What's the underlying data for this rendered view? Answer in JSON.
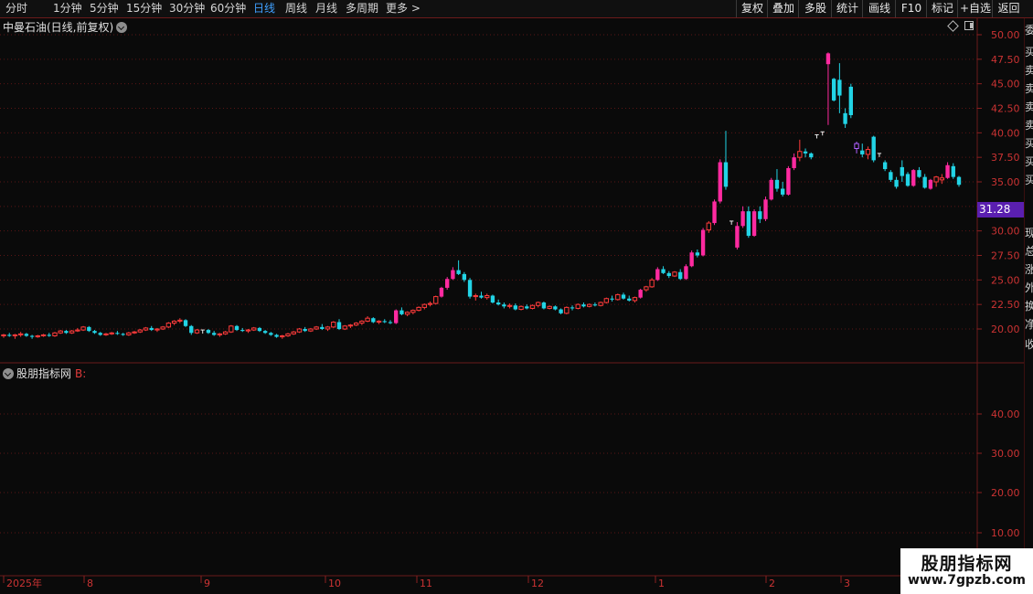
{
  "toolbar": {
    "left": [
      "分时",
      "1分钟",
      "5分钟",
      "15分钟",
      "30分钟",
      "60分钟",
      "日线",
      "周线",
      "月线",
      "多周期",
      "更多 >"
    ],
    "active_index": 6,
    "right": [
      "复权",
      "叠加",
      "多股",
      "统计",
      "画线",
      "F10",
      "标记",
      "+自选",
      "返回"
    ]
  },
  "chart": {
    "title": "中曼石油(日线,前复权)",
    "last_price": "31.28",
    "price_ticks": [
      "50.00",
      "47.50",
      "45.00",
      "42.50",
      "40.00",
      "37.50",
      "35.00",
      "32.50",
      "30.00",
      "27.50",
      "25.00",
      "22.50",
      "20.00"
    ],
    "annotation_high": "T",
    "annotation_low": "T"
  },
  "indicator": {
    "title": "股朋指标网",
    "series_label": "B:",
    "ticks": [
      "40.00",
      "30.00",
      "20.00",
      "10.00"
    ]
  },
  "date_axis": {
    "labels": [
      "2025年",
      "8",
      "9",
      "10",
      "11",
      "12",
      "1",
      "2",
      "3"
    ]
  },
  "sidebar": {
    "chars": [
      "委",
      "买",
      "卖",
      "卖",
      "卖",
      "卖",
      "买",
      "买",
      "买",
      "现",
      "总",
      "涨",
      "外",
      "换",
      "净",
      "收"
    ]
  },
  "watermark": {
    "title": "股朋指标网",
    "url": "www.7gpzb.com"
  },
  "colors": {
    "up": "#ff3b3b",
    "up_strong": "#ff2aa0",
    "down": "#22d4e6",
    "grid": "#6b1a1a",
    "active_tab": "#3fa0ff",
    "last_price_bg": "#5a1fb0"
  },
  "chart_data": {
    "type": "candlestick",
    "ylim": [
      17.5,
      51.0
    ],
    "x_categories": [
      "2025-07",
      "2025-08",
      "2025-09",
      "2025-10",
      "2025-11",
      "2025-12",
      "2026-01",
      "2026-02",
      "2026-03"
    ],
    "candles": [
      [
        19.3,
        19.5,
        19.1,
        19.4
      ],
      [
        19.4,
        19.6,
        19.2,
        19.3
      ],
      [
        19.3,
        19.5,
        19.0,
        19.4
      ],
      [
        19.4,
        19.7,
        19.2,
        19.5
      ],
      [
        19.5,
        19.6,
        19.2,
        19.3
      ],
      [
        19.3,
        19.4,
        19.0,
        19.2
      ],
      [
        19.2,
        19.4,
        19.1,
        19.3
      ],
      [
        19.3,
        19.5,
        19.2,
        19.4
      ],
      [
        19.4,
        19.6,
        19.2,
        19.3
      ],
      [
        19.3,
        19.7,
        19.2,
        19.6
      ],
      [
        19.6,
        19.9,
        19.5,
        19.8
      ],
      [
        19.8,
        19.9,
        19.5,
        19.6
      ],
      [
        19.6,
        19.9,
        19.5,
        19.8
      ],
      [
        19.8,
        20.1,
        19.7,
        19.9
      ],
      [
        19.9,
        20.3,
        19.8,
        20.2
      ],
      [
        20.2,
        20.3,
        19.7,
        19.8
      ],
      [
        19.8,
        19.9,
        19.5,
        19.6
      ],
      [
        19.6,
        19.7,
        19.3,
        19.4
      ],
      [
        19.4,
        19.6,
        19.3,
        19.5
      ],
      [
        19.5,
        19.7,
        19.4,
        19.6
      ],
      [
        19.6,
        19.8,
        19.4,
        19.5
      ],
      [
        19.5,
        19.6,
        19.3,
        19.4
      ],
      [
        19.4,
        19.7,
        19.3,
        19.6
      ],
      [
        19.6,
        19.8,
        19.5,
        19.7
      ],
      [
        19.7,
        20.0,
        19.6,
        19.9
      ],
      [
        19.9,
        20.2,
        19.8,
        20.1
      ],
      [
        20.1,
        20.3,
        19.8,
        19.9
      ],
      [
        19.9,
        20.1,
        19.7,
        20.0
      ],
      [
        20.0,
        20.3,
        19.9,
        20.2
      ],
      [
        20.2,
        20.7,
        20.1,
        20.6
      ],
      [
        20.6,
        20.9,
        20.4,
        20.8
      ],
      [
        20.8,
        21.1,
        20.6,
        20.9
      ],
      [
        20.9,
        21.0,
        20.2,
        20.3
      ],
      [
        20.3,
        20.4,
        19.4,
        19.6
      ],
      [
        19.6,
        20.0,
        19.5,
        19.9
      ],
      [
        19.9,
        20.1,
        19.8,
        19.9
      ],
      [
        19.9,
        20.0,
        19.5,
        19.6
      ],
      [
        19.6,
        19.8,
        19.3,
        19.4
      ],
      [
        19.4,
        19.6,
        19.2,
        19.5
      ],
      [
        19.5,
        19.8,
        19.4,
        19.7
      ],
      [
        19.7,
        20.4,
        19.6,
        20.3
      ],
      [
        20.3,
        20.4,
        19.8,
        19.9
      ],
      [
        19.9,
        20.1,
        19.7,
        19.8
      ],
      [
        19.8,
        20.0,
        19.6,
        19.9
      ],
      [
        19.9,
        20.2,
        19.8,
        20.1
      ],
      [
        20.1,
        20.2,
        19.7,
        19.8
      ],
      [
        19.8,
        19.9,
        19.5,
        19.6
      ],
      [
        19.6,
        19.7,
        19.3,
        19.4
      ],
      [
        19.4,
        19.5,
        19.1,
        19.2
      ],
      [
        19.2,
        19.4,
        19.0,
        19.3
      ],
      [
        19.3,
        19.6,
        19.2,
        19.5
      ],
      [
        19.5,
        19.8,
        19.4,
        19.7
      ],
      [
        19.7,
        20.1,
        19.6,
        20.0
      ],
      [
        20.0,
        20.2,
        19.7,
        19.8
      ],
      [
        19.8,
        20.1,
        19.7,
        20.0
      ],
      [
        20.0,
        20.3,
        19.9,
        20.2
      ],
      [
        20.2,
        20.5,
        19.9,
        20.0
      ],
      [
        20.0,
        20.3,
        19.8,
        20.2
      ],
      [
        20.2,
        20.8,
        20.1,
        20.7
      ],
      [
        20.7,
        21.0,
        19.9,
        20.0
      ],
      [
        20.0,
        20.4,
        19.9,
        20.3
      ],
      [
        20.3,
        20.5,
        20.1,
        20.4
      ],
      [
        20.4,
        20.7,
        20.3,
        20.6
      ],
      [
        20.6,
        20.9,
        20.4,
        20.8
      ],
      [
        20.8,
        21.3,
        20.7,
        21.1
      ],
      [
        21.1,
        21.2,
        20.6,
        20.7
      ],
      [
        20.7,
        20.9,
        20.5,
        20.8
      ],
      [
        20.8,
        21.0,
        20.6,
        20.7
      ],
      [
        20.7,
        20.9,
        20.5,
        20.6
      ],
      [
        20.6,
        22.0,
        20.5,
        21.9
      ],
      [
        21.9,
        22.2,
        21.4,
        21.5
      ],
      [
        21.5,
        21.8,
        21.3,
        21.7
      ],
      [
        21.7,
        22.0,
        21.5,
        21.9
      ],
      [
        21.9,
        22.3,
        21.8,
        22.2
      ],
      [
        22.2,
        22.6,
        22.0,
        22.5
      ],
      [
        22.5,
        22.8,
        22.3,
        22.6
      ],
      [
        22.6,
        23.4,
        22.5,
        23.3
      ],
      [
        23.3,
        24.3,
        23.2,
        24.2
      ],
      [
        24.2,
        25.3,
        24.0,
        25.1
      ],
      [
        25.1,
        26.3,
        25.0,
        26.0
      ],
      [
        26.0,
        27.0,
        25.5,
        25.6
      ],
      [
        25.6,
        25.8,
        24.8,
        25.0
      ],
      [
        25.0,
        25.2,
        23.1,
        23.3
      ],
      [
        23.3,
        23.6,
        22.9,
        23.4
      ],
      [
        23.4,
        23.8,
        23.1,
        23.2
      ],
      [
        23.2,
        23.6,
        23.0,
        23.4
      ],
      [
        23.4,
        23.5,
        22.6,
        22.7
      ],
      [
        22.7,
        23.0,
        22.4,
        22.5
      ],
      [
        22.5,
        22.7,
        22.1,
        22.3
      ],
      [
        22.3,
        22.6,
        22.1,
        22.4
      ],
      [
        22.4,
        22.6,
        21.9,
        22.0
      ],
      [
        22.0,
        22.4,
        21.9,
        22.3
      ],
      [
        22.3,
        22.5,
        22.0,
        22.1
      ],
      [
        22.1,
        22.5,
        22.0,
        22.4
      ],
      [
        22.4,
        22.8,
        22.2,
        22.7
      ],
      [
        22.7,
        22.8,
        22.0,
        22.1
      ],
      [
        22.1,
        22.4,
        22.0,
        22.3
      ],
      [
        22.3,
        22.4,
        21.9,
        22.0
      ],
      [
        22.0,
        22.1,
        21.5,
        21.6
      ],
      [
        21.6,
        22.3,
        21.5,
        22.2
      ],
      [
        22.2,
        22.4,
        21.9,
        22.1
      ],
      [
        22.1,
        22.6,
        22.0,
        22.5
      ],
      [
        22.5,
        22.7,
        22.2,
        22.3
      ],
      [
        22.3,
        22.6,
        22.2,
        22.5
      ],
      [
        22.5,
        22.7,
        22.3,
        22.4
      ],
      [
        22.4,
        22.8,
        22.3,
        22.7
      ],
      [
        22.7,
        23.2,
        22.6,
        23.1
      ],
      [
        23.1,
        23.4,
        22.8,
        23.0
      ],
      [
        23.0,
        23.6,
        22.9,
        23.5
      ],
      [
        23.5,
        23.7,
        23.0,
        23.1
      ],
      [
        23.1,
        23.4,
        22.8,
        22.9
      ],
      [
        22.9,
        23.3,
        22.7,
        23.2
      ],
      [
        23.2,
        24.1,
        23.1,
        24.0
      ],
      [
        24.0,
        24.4,
        23.8,
        24.3
      ],
      [
        24.3,
        25.2,
        24.2,
        25.0
      ],
      [
        25.0,
        26.3,
        24.9,
        26.1
      ],
      [
        26.1,
        26.4,
        25.6,
        25.7
      ],
      [
        25.7,
        25.9,
        25.2,
        25.4
      ],
      [
        25.4,
        25.9,
        25.3,
        25.8
      ],
      [
        25.8,
        26.1,
        25.0,
        25.1
      ],
      [
        25.1,
        26.6,
        25.0,
        26.4
      ],
      [
        26.4,
        28.0,
        26.3,
        27.8
      ],
      [
        27.8,
        28.1,
        27.3,
        27.5
      ],
      [
        27.5,
        30.3,
        27.4,
        30.1
      ],
      [
        30.1,
        31.0,
        29.8,
        30.8
      ],
      [
        30.8,
        33.2,
        30.6,
        33.0
      ],
      [
        33.0,
        37.3,
        32.8,
        37.0
      ],
      [
        37.0,
        40.2,
        34.2,
        34.5
      ],
      [
        31.0,
        31.1,
        31.0,
        31.0
      ],
      [
        28.3,
        30.9,
        28.1,
        30.5
      ],
      [
        30.5,
        32.5,
        30.3,
        32.0
      ],
      [
        32.0,
        32.5,
        29.3,
        29.5
      ],
      [
        29.5,
        32.2,
        29.4,
        32.0
      ],
      [
        32.0,
        32.5,
        30.8,
        31.2
      ],
      [
        31.2,
        33.5,
        31.0,
        33.2
      ],
      [
        33.2,
        35.4,
        33.1,
        35.2
      ],
      [
        35.2,
        36.3,
        34.0,
        34.3
      ],
      [
        34.3,
        35.0,
        33.5,
        33.7
      ],
      [
        33.7,
        36.6,
        33.6,
        36.4
      ],
      [
        36.4,
        37.9,
        36.2,
        37.5
      ],
      [
        37.5,
        39.3,
        37.1,
        38.1
      ],
      [
        38.1,
        38.4,
        37.5,
        37.9
      ],
      [
        37.9,
        38.0,
        37.3,
        37.5
      ],
      [
        39.8,
        39.9,
        39.8,
        39.8
      ],
      [
        40.1,
        40.2,
        40.0,
        40.1
      ],
      [
        47.0,
        48.2,
        40.8,
        48.1
      ],
      [
        45.5,
        45.6,
        43.2,
        43.3
      ],
      [
        45.4,
        47.1,
        42.0,
        43.8
      ],
      [
        42.0,
        42.5,
        40.5,
        40.9
      ],
      [
        44.7,
        45.0,
        41.5,
        41.8
      ],
      [
        38.4,
        39.1,
        37.9,
        38.9
      ],
      [
        38.2,
        38.9,
        37.5,
        37.8
      ],
      [
        37.8,
        38.6,
        37.3,
        38.3
      ],
      [
        39.6,
        39.7,
        37.0,
        37.2
      ],
      [
        37.9,
        39.4,
        37.0,
        37.9
      ],
      [
        37.0,
        37.2,
        36.1,
        36.3
      ],
      [
        36.0,
        36.2,
        35.0,
        35.2
      ],
      [
        35.2,
        35.5,
        34.3,
        34.5
      ],
      [
        36.5,
        37.2,
        35.0,
        35.6
      ],
      [
        35.8,
        36.0,
        34.5,
        34.6
      ],
      [
        34.6,
        36.3,
        34.5,
        36.2
      ],
      [
        36.2,
        36.5,
        35.4,
        35.5
      ],
      [
        35.5,
        35.8,
        34.3,
        34.4
      ],
      [
        34.3,
        35.3,
        34.2,
        35.2
      ],
      [
        35.0,
        35.6,
        34.5,
        35.5
      ],
      [
        35.2,
        35.8,
        34.8,
        35.4
      ],
      [
        35.4,
        37.0,
        35.3,
        36.7
      ],
      [
        36.6,
        36.9,
        35.3,
        35.5
      ],
      [
        35.5,
        35.6,
        34.5,
        34.7
      ]
    ]
  }
}
